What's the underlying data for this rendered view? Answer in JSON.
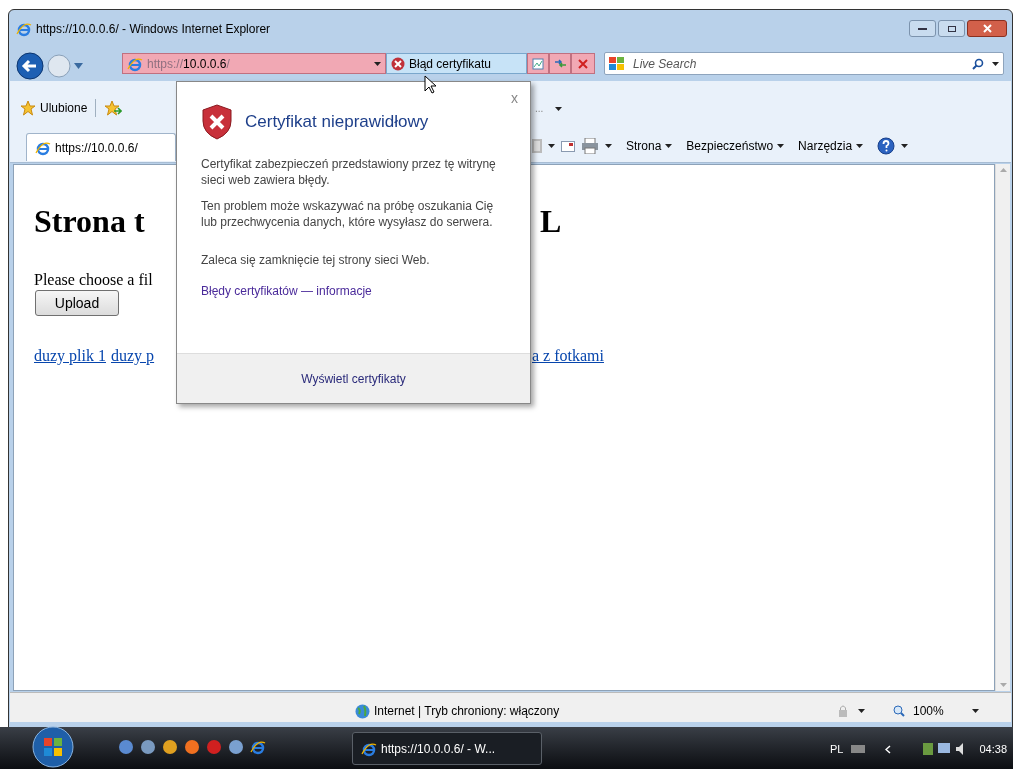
{
  "window": {
    "title": "https://10.0.0.6/ - Windows Internet Explorer"
  },
  "address": {
    "scheme": "https://",
    "host": "10.0.0.6",
    "path": "/",
    "cert_error": "Błąd certyfikatu"
  },
  "search": {
    "placeholder": "Live Search"
  },
  "favorites_bar": {
    "label": "Ulubione",
    "more": "..."
  },
  "tab": {
    "label": "https://10.0.0.6/"
  },
  "toolbar": [
    {
      "label": "Strona"
    },
    {
      "label": "Bezpieczeństwo"
    },
    {
      "label": "Narzędzia"
    }
  ],
  "page": {
    "heading_parts": [
      "Strona t",
      "L"
    ],
    "prompt": "Please choose a fil",
    "upload": "Upload",
    "links_left": [
      "duzy plik 1",
      "duzy p"
    ],
    "links_right": [
      "a z fotkami"
    ]
  },
  "popup": {
    "title": "Certyfikat nieprawidłowy",
    "close": "x",
    "paragraphs": [
      "Certyfikat zabezpieczeń przedstawiony przez tę witrynę sieci web zawiera błędy.",
      "Ten problem może wskazywać na próbę oszukania Cię lub przechwycenia danych, które wysyłasz do serwera.",
      "Zaleca się zamknięcie tej strony sieci Web."
    ],
    "link": "Błędy certyfikatów — informacje",
    "footer": "Wyświetl certyfikaty"
  },
  "status_bar": {
    "zone": "Internet | Tryb chroniony: włączony",
    "zoom": "100%"
  },
  "taskbar": {
    "window": "https://10.0.0.6/ - W...",
    "language": "PL",
    "clock": "04:38"
  }
}
